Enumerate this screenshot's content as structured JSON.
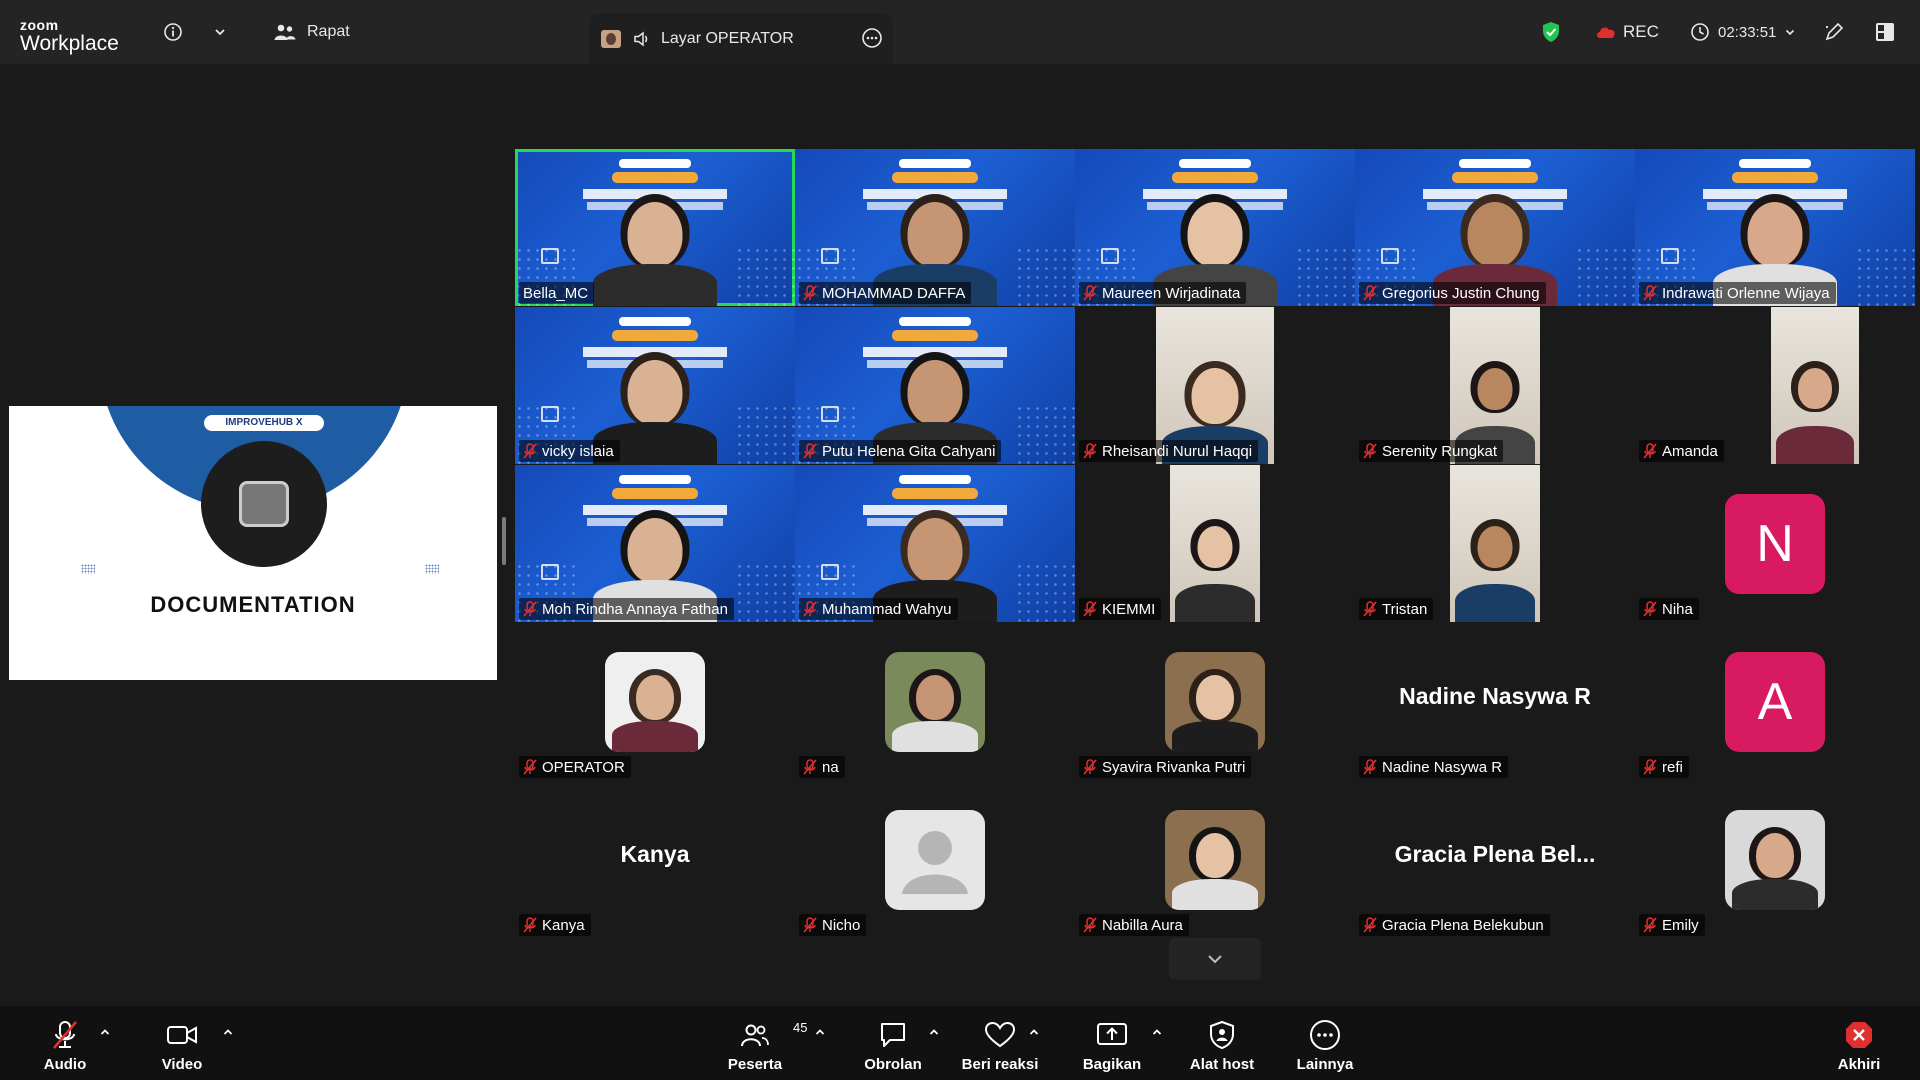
{
  "topbar": {
    "logo_small": "zoom",
    "logo_big": "Workplace",
    "meeting_label": "Rapat",
    "share_label": "Layar OPERATOR",
    "rec_label": "REC",
    "timer": "02:33:51"
  },
  "share": {
    "brand": "IMPROVEHUB X",
    "title": "DOCUMENTATION"
  },
  "participants": [
    {
      "name": "Bella_MC",
      "muted": false,
      "type": "webinar",
      "active": true
    },
    {
      "name": "MOHAMMAD DAFFA",
      "muted": true,
      "type": "webinar"
    },
    {
      "name": "Maureen Wirjadinata",
      "muted": true,
      "type": "webinar"
    },
    {
      "name": "Gregorius Justin Chung",
      "muted": true,
      "type": "webinar"
    },
    {
      "name": "Indrawati Orlenne Wijaya",
      "muted": true,
      "type": "webinar"
    },
    {
      "name": "vicky islaia",
      "muted": true,
      "type": "webinar"
    },
    {
      "name": "Putu Helena Gita Cahyani",
      "muted": true,
      "type": "webinar"
    },
    {
      "name": "Rheisandi Nurul Haqqi",
      "muted": true,
      "type": "video"
    },
    {
      "name": "Serenity Rungkat",
      "muted": true,
      "type": "video"
    },
    {
      "name": "Amanda",
      "muted": true,
      "type": "video"
    },
    {
      "name": "Moh Rindha Annaya Fathan",
      "muted": true,
      "type": "webinar"
    },
    {
      "name": "Muhammad Wahyu",
      "muted": true,
      "type": "webinar"
    },
    {
      "name": "KIEMMI",
      "muted": true,
      "type": "video"
    },
    {
      "name": "Tristan",
      "muted": true,
      "type": "video"
    },
    {
      "name": "Niha",
      "muted": true,
      "type": "initial",
      "initial": "N",
      "color": "#d81b60"
    },
    {
      "name": "OPERATOR",
      "muted": true,
      "type": "photo"
    },
    {
      "name": "na",
      "muted": true,
      "type": "photo"
    },
    {
      "name": "Syavira Rivanka Putri",
      "muted": true,
      "type": "photo"
    },
    {
      "name": "Nadine Nasywa R",
      "muted": true,
      "type": "name",
      "display": "Nadine Nasywa R"
    },
    {
      "name": "refi",
      "muted": true,
      "type": "initial",
      "initial": "A",
      "color": "#d81b60"
    },
    {
      "name": "Kanya",
      "muted": true,
      "type": "name",
      "display": "Kanya"
    },
    {
      "name": "Nicho",
      "muted": true,
      "type": "photo-default"
    },
    {
      "name": "Nabilla Aura",
      "muted": true,
      "type": "photo"
    },
    {
      "name": "Gracia Plena Belekubun",
      "muted": true,
      "type": "name",
      "display": "Gracia  Plena  Bel..."
    },
    {
      "name": "Emily",
      "muted": true,
      "type": "photo"
    }
  ],
  "toolbar": {
    "audio": "Audio",
    "video": "Video",
    "participants": "Peserta",
    "participants_count": "45",
    "chat": "Obrolan",
    "react": "Beri reaksi",
    "share": "Bagikan",
    "host_tools": "Alat host",
    "more": "Lainnya",
    "end": "Akhiri"
  },
  "colors": {
    "active_speaker": "#23d959",
    "muted_icon": "#e02f2f",
    "initial_avatar": "#d81b60",
    "end_button": "#e02f2f"
  }
}
